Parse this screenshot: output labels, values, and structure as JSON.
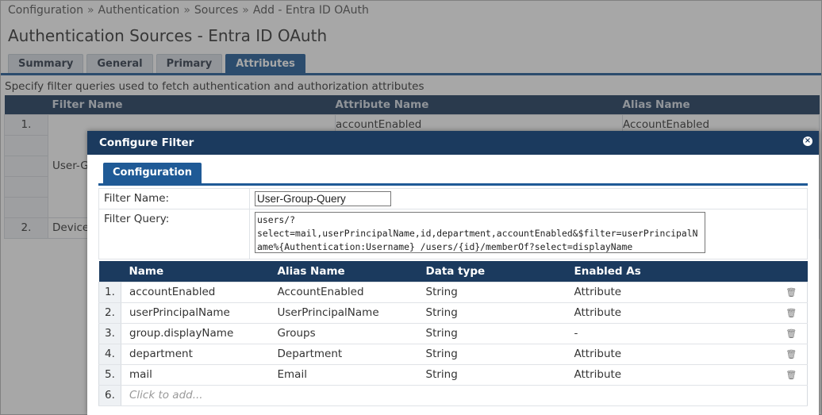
{
  "breadcrumb": [
    "Configuration",
    "Authentication",
    "Sources",
    "Add - Entra ID OAuth"
  ],
  "breadcrumb_sep": "»",
  "page_title": "Authentication Sources - Entra ID OAuth",
  "tabs": [
    {
      "label": "Summary",
      "active": false
    },
    {
      "label": "General",
      "active": false
    },
    {
      "label": "Primary",
      "active": false
    },
    {
      "label": "Attributes",
      "active": true
    }
  ],
  "description": "Specify filter queries used to fetch authentication and authorization attributes",
  "bg_table": {
    "headers": [
      "Filter Name",
      "Attribute Name",
      "Alias Name"
    ],
    "rows": [
      {
        "num": "1.",
        "filter": "User-G",
        "attribute": "accountEnabled",
        "alias": "AccountEnabled"
      },
      {
        "num": "2.",
        "filter": "Device",
        "attribute": "",
        "alias": ""
      }
    ]
  },
  "modal": {
    "title": "Configure Filter",
    "tab": "Configuration",
    "filter_name_label": "Filter Name:",
    "filter_name_value": "User-Group-Query",
    "filter_query_label": "Filter Query:",
    "filter_query_value": "users/?\nselect=mail,userPrincipalName,id,department,accountEnabled&$filter=userPrincipalName%{Authentication:Username} /users/{id}/memberOf?select=displayName",
    "table_headers": [
      "Name",
      "Alias Name",
      "Data type",
      "Enabled As"
    ],
    "rows": [
      {
        "num": "1.",
        "name": "accountEnabled",
        "alias": "AccountEnabled",
        "type": "String",
        "enabled": "Attribute"
      },
      {
        "num": "2.",
        "name": "userPrincipalName",
        "alias": "UserPrincipalName",
        "type": "String",
        "enabled": "Attribute"
      },
      {
        "num": "3.",
        "name": "group.displayName",
        "alias": "Groups",
        "type": "String",
        "enabled": "-"
      },
      {
        "num": "4.",
        "name": "department",
        "alias": "Department",
        "type": "String",
        "enabled": "Attribute"
      },
      {
        "num": "5.",
        "name": "mail",
        "alias": "Email",
        "type": "String",
        "enabled": "Attribute"
      }
    ],
    "add_row": {
      "num": "6.",
      "placeholder": "Click to add..."
    }
  },
  "colors": {
    "accent": "#1f5a96",
    "header_dark": "#1b3a5e"
  }
}
